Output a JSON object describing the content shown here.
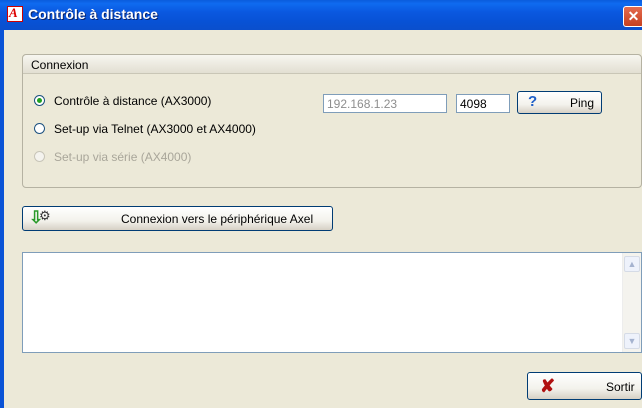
{
  "window": {
    "title": "Contrôle à distance",
    "close_glyph": "✕",
    "app_icon_letter": "A"
  },
  "connexion": {
    "group_title": "Connexion",
    "options": [
      {
        "label": "Contrôle à distance (AX3000)",
        "checked": true,
        "disabled": false
      },
      {
        "label": "Set-up via Telnet (AX3000 et AX4000)",
        "checked": false,
        "disabled": false
      },
      {
        "label": "Set-up via série (AX4000)",
        "checked": false,
        "disabled": true
      }
    ],
    "ip_address": "192.168.1.23",
    "port": "4098",
    "ping_label": "Ping",
    "ping_icon": "question-icon"
  },
  "connect": {
    "label": "Connexion vers le périphérique Axel",
    "icon": "download-gear-icon"
  },
  "log": {
    "content": ""
  },
  "footer": {
    "quit_label": "Sortir",
    "quit_icon": "x-cross-icon"
  },
  "colors": {
    "titlebar": "#0a5cdc",
    "dialog_bg": "#ece9d8",
    "checked_radio": "#21a121"
  }
}
